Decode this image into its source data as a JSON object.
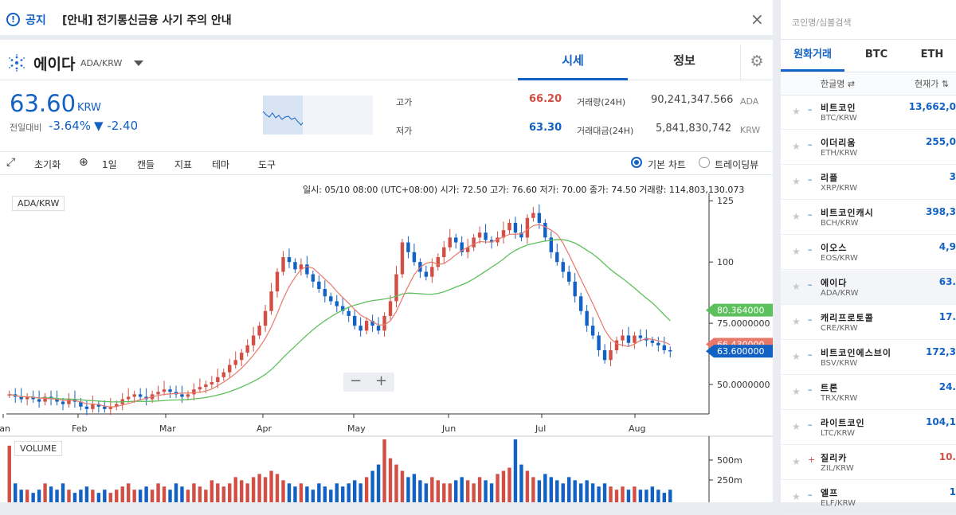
{
  "notice": {
    "label": "공지",
    "text": "[안내] 전기통신금융 사기 주의 안내",
    "close": "×"
  },
  "coin": {
    "name": "에이다",
    "symbol": "ADA/KRW",
    "tab_quote": "시세",
    "tab_info": "정보"
  },
  "price": {
    "current": "63.60",
    "unit": "KRW",
    "prev_label": "전일대비",
    "change_pct": "-3.64%",
    "change_abs": "▼ -2.40"
  },
  "stats": {
    "high_label": "고가",
    "high": "66.20",
    "low_label": "저가",
    "low": "63.30",
    "vol_label": "거래량(24H)",
    "vol": "90,241,347.566",
    "vol_unit": "ADA",
    "amt_label": "거래대금(24H)",
    "amt": "5,841,830,742",
    "amt_unit": "KRW"
  },
  "toolbar": {
    "reset": "초기화",
    "period": "1일",
    "candle": "캔들",
    "indicator": "지표",
    "theme": "테마",
    "tools": "도구",
    "basic_chart": "기본 차트",
    "tradingview": "트레이딩뷰"
  },
  "chart_info": "일시: 05/10 08:00 (UTC+08:00) 시가: 72.50 고가: 76.60 저가: 70.00 종가: 74.50 거래량: 114,803,130.073",
  "chart_data": {
    "type": "candlestick",
    "legend": "ADA/KRW",
    "volume_label": "VOLUME",
    "x_ticks": [
      "Jan",
      "Feb",
      "Mar",
      "Apr",
      "May",
      "Jun",
      "Jul",
      "Aug"
    ],
    "y_ticks": [
      "125",
      "100",
      "75.0000000",
      "50.0000000"
    ],
    "ylim": [
      38,
      128
    ],
    "vol_ticks": [
      "500m",
      "250m"
    ],
    "price_tags": {
      "ma_long": "80.364000",
      "ma_short": "66.430000",
      "last": "63.600000"
    },
    "ma_long_color": "#5cc05c",
    "ma_short_color": "#e8786a",
    "up_color": "#d24f45",
    "down_color": "#1261c4",
    "close_series": [
      46,
      45,
      44,
      45,
      44,
      43,
      45,
      44,
      43,
      42,
      44,
      43,
      41,
      40,
      42,
      41,
      40,
      41,
      42,
      44,
      45,
      46,
      45,
      44,
      46,
      47,
      48,
      47,
      46,
      45,
      46,
      48,
      49,
      50,
      51,
      53,
      55,
      58,
      60,
      63,
      66,
      70,
      74,
      80,
      88,
      96,
      102,
      100,
      97,
      99,
      95,
      92,
      89,
      86,
      84,
      82,
      80,
      78,
      74,
      72,
      76,
      74,
      72,
      78,
      84,
      95,
      108,
      104,
      100,
      96,
      94,
      98,
      102,
      106,
      110,
      108,
      104,
      106,
      110,
      112,
      109,
      108,
      110,
      113,
      116,
      112,
      110,
      118,
      120,
      116,
      110,
      104,
      100,
      96,
      92,
      86,
      80,
      74,
      70,
      64,
      60,
      64,
      68,
      70,
      67,
      70,
      69,
      68,
      67,
      66,
      64,
      63.6
    ],
    "volume_series": [
      0.9,
      0.3,
      0.2,
      0.2,
      0.15,
      0.2,
      0.3,
      0.25,
      0.2,
      0.3,
      0.2,
      0.15,
      0.2,
      0.25,
      0.2,
      0.15,
      0.2,
      0.15,
      0.2,
      0.25,
      0.3,
      0.2,
      0.2,
      0.25,
      0.2,
      0.3,
      0.25,
      0.2,
      0.3,
      0.25,
      0.2,
      0.3,
      0.25,
      0.2,
      0.35,
      0.3,
      0.25,
      0.3,
      0.4,
      0.35,
      0.3,
      0.4,
      0.45,
      0.4,
      0.5,
      0.45,
      0.35,
      0.3,
      0.25,
      0.3,
      0.25,
      0.2,
      0.3,
      0.25,
      0.2,
      0.3,
      0.25,
      0.3,
      0.35,
      0.3,
      0.4,
      0.5,
      0.6,
      1.0,
      0.7,
      0.6,
      0.5,
      0.4,
      0.45,
      0.35,
      0.3,
      0.4,
      0.35,
      0.3,
      0.3,
      0.35,
      0.4,
      0.35,
      0.3,
      0.4,
      0.35,
      0.3,
      0.45,
      0.5,
      0.55,
      1.0,
      0.6,
      0.5,
      0.4,
      0.35,
      0.45,
      0.4,
      0.35,
      0.3,
      0.4,
      0.35,
      0.3,
      0.35,
      0.3,
      0.25,
      0.3,
      0.25,
      0.2,
      0.25,
      0.2,
      0.25,
      0.2,
      0.2,
      0.25,
      0.2,
      0.15,
      0.2
    ]
  },
  "sidebar": {
    "search_placeholder": "코인명/심볼검색",
    "tabs": [
      "원화거래",
      "BTC",
      "ETH"
    ],
    "col_name": "한글명 ⇄",
    "col_price": "현재가 ⇅",
    "rows": [
      {
        "kn": "비트코인",
        "sym": "BTC/KRW",
        "val": "13,662,0",
        "mark": "–",
        "color": "#1261c4"
      },
      {
        "kn": "이더리움",
        "sym": "ETH/KRW",
        "val": "255,0",
        "mark": "–",
        "color": "#1261c4"
      },
      {
        "kn": "리플",
        "sym": "XRP/KRW",
        "val": "3",
        "mark": "–",
        "color": "#1261c4"
      },
      {
        "kn": "비트코인캐시",
        "sym": "BCH/KRW",
        "val": "398,3",
        "mark": "–",
        "color": "#1261c4"
      },
      {
        "kn": "이오스",
        "sym": "EOS/KRW",
        "val": "4,9",
        "mark": "–",
        "color": "#1261c4"
      },
      {
        "kn": "에이다",
        "sym": "ADA/KRW",
        "val": "63.",
        "mark": "–",
        "color": "#1261c4"
      },
      {
        "kn": "캐리프로토콜",
        "sym": "CRE/KRW",
        "val": "17.",
        "mark": "–",
        "color": "#1261c4"
      },
      {
        "kn": "비트코인에스브이",
        "sym": "BSV/KRW",
        "val": "172,3",
        "mark": "–",
        "color": "#1261c4"
      },
      {
        "kn": "트론",
        "sym": "TRX/KRW",
        "val": "24.",
        "mark": "–",
        "color": "#1261c4"
      },
      {
        "kn": "라이트코인",
        "sym": "LTC/KRW",
        "val": "104,1",
        "mark": "–",
        "color": "#1261c4"
      },
      {
        "kn": "질리카",
        "sym": "ZIL/KRW",
        "val": "10.",
        "mark": "+",
        "color": "#d24f45"
      },
      {
        "kn": "엘프",
        "sym": "ELF/KRW",
        "val": "1",
        "mark": "–",
        "color": "#1261c4"
      }
    ]
  }
}
